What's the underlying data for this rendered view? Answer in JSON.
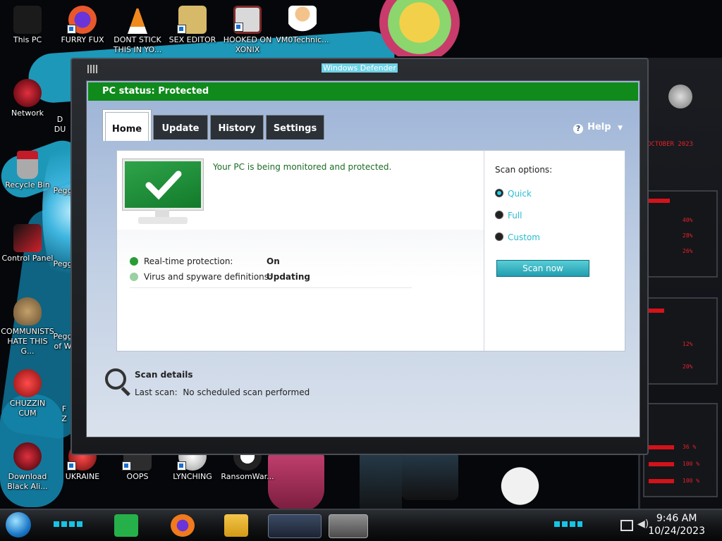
{
  "desktop": {
    "icons": [
      {
        "label": "This PC",
        "color": "#1b1b1b"
      },
      {
        "label": "FURRY FUX",
        "color": "#e8582a"
      },
      {
        "label": "DONT STICK THIS IN YO...",
        "color": "#f08a1d"
      },
      {
        "label": "SEX EDITOR",
        "color": "#d7b96a"
      },
      {
        "label": "HOOKED ON XONIX",
        "color": "#7d2a2a"
      },
      {
        "label": "VM0Technic...",
        "color": "#f4c38c"
      },
      {
        "label": "Network",
        "color": "#b01322"
      },
      {
        "label": "Recycle Bin",
        "color": "#c21b2a"
      },
      {
        "label": "Control Panel",
        "color": "#d1212c"
      },
      {
        "label": "COMMUNISTS HATE THIS G...",
        "color": "#6a5233"
      },
      {
        "label": "CHUZZIN CUM",
        "color": "#d81e1e"
      },
      {
        "label": "Download Black Ali...",
        "color": "#a51623"
      },
      {
        "label": "UKRAINE",
        "color": "#c71b1b"
      },
      {
        "label": "OOPS",
        "color": "#2d2d2d"
      },
      {
        "label": "LYNCHING",
        "color": "#cfcfcf"
      },
      {
        "label": "RansomWar...",
        "color": "#e0e0e0"
      }
    ],
    "partial_labels": [
      "D",
      "DU",
      "Pegg",
      "Pegg",
      "Pegg",
      "of W",
      "F",
      "Z"
    ]
  },
  "hud": {
    "readouts": [
      "40%",
      "28%",
      "26%",
      "12%",
      "20%",
      "36 %",
      "100 %",
      "100 %"
    ],
    "date": "OCTOBER 2023",
    "accent": "#d4121a"
  },
  "window": {
    "title": "Windows Defender",
    "status": "PC status: Protected",
    "status_color": "#0f8a1b",
    "tabs": [
      "Home",
      "Update",
      "History",
      "Settings"
    ],
    "active_tab": "Home",
    "help_label": "Help",
    "protected_message": "Your PC is being monitored and protected.",
    "rows": [
      {
        "label": "Real-time protection:",
        "value": "On"
      },
      {
        "label": "Virus and spyware definitions:",
        "value": "Updating"
      }
    ],
    "scan_options_label": "Scan options:",
    "scan_options": [
      "Quick",
      "Full",
      "Custom"
    ],
    "selected_option": "Quick",
    "scan_button": "Scan now",
    "scan_details_title": "Scan details",
    "last_scan_label": "Last scan:",
    "last_scan_value": "No scheduled scan performed"
  },
  "taskbar": {
    "time": "9:46 AM",
    "date": "10/24/2023",
    "pinned": [
      "start-orb",
      "notes-icon",
      "firefox-icon",
      "file-explorer-icon",
      "defender-window-icon",
      "castle-app-icon"
    ]
  }
}
